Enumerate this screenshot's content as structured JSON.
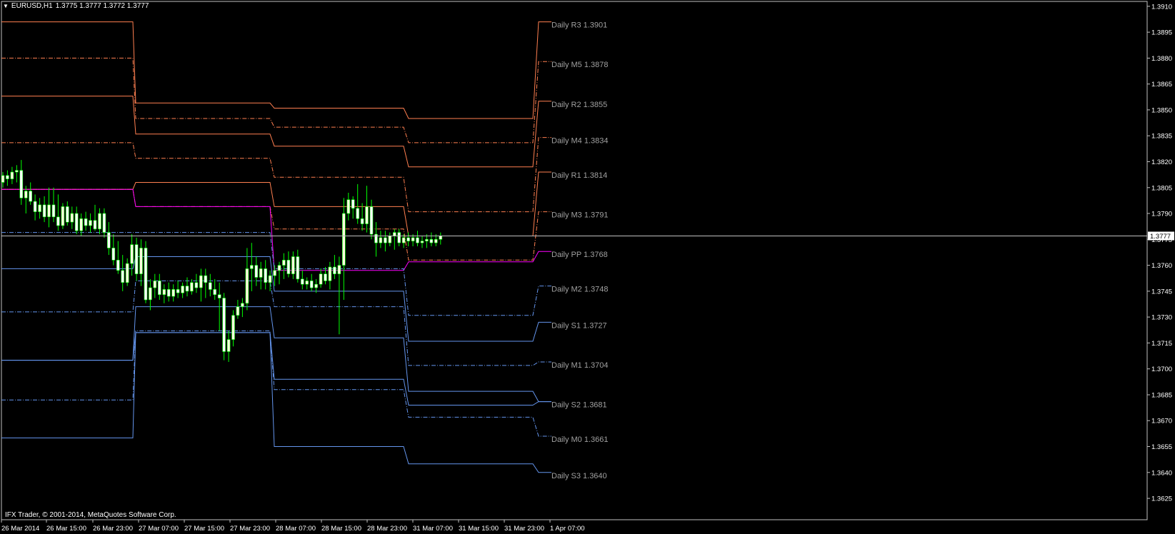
{
  "header": {
    "symbol": "EURUSD,H1",
    "ohlc": "1.3775 1.3777 1.3772 1.3777"
  },
  "copyright": "IFX Trader, © 2001-2014, MetaQuotes Software Corp.",
  "colors": {
    "background": "#000000",
    "frame": "#c0c0c0",
    "axis_text": "#ffffff",
    "level_label": "#a0a0a0",
    "resistance": "#ff7f50",
    "pivot": "#ff00ff",
    "support": "#6495ed",
    "bull_body": "#ffffe0",
    "bear_body": "#ffffff",
    "wick": "#00ff00",
    "bid_line": "#c0c0c0"
  },
  "chart_data": {
    "type": "candlestick",
    "symbol": "EURUSD",
    "timeframe": "H1",
    "ylim": [
      1.3618,
      1.3912
    ],
    "y_ticks": [
      "1.3910",
      "1.3895",
      "1.3880",
      "1.3865",
      "1.3850",
      "1.3835",
      "1.3820",
      "1.3805",
      "1.3790",
      "1.3775",
      "1.3760",
      "1.3745",
      "1.3730",
      "1.3715",
      "1.3700",
      "1.3685",
      "1.3670",
      "1.3655",
      "1.3640",
      "1.3625"
    ],
    "x_ticks": [
      "26 Mar 2014",
      "26 Mar 15:00",
      "26 Mar 23:00",
      "27 Mar 07:00",
      "27 Mar 15:00",
      "27 Mar 23:00",
      "28 Mar 07:00",
      "28 Mar 15:00",
      "28 Mar 23:00",
      "31 Mar 07:00",
      "31 Mar 15:00",
      "31 Mar 23:00",
      "1 Apr 07:00"
    ],
    "current_price": "1.3777",
    "levels": [
      {
        "name": "R3",
        "label": "Daily R3 1.3901",
        "kind": "resistance",
        "style": "solid",
        "values": [
          1.3901,
          1.3854,
          1.3851,
          1.3845,
          1.3901
        ]
      },
      {
        "name": "M5",
        "label": "Daily M5 1.3878",
        "kind": "resistance",
        "style": "dashdot",
        "values": [
          1.388,
          1.3845,
          1.384,
          1.3831,
          1.3878
        ]
      },
      {
        "name": "R2",
        "label": "Daily R2 1.3855",
        "kind": "resistance",
        "style": "solid",
        "values": [
          1.3858,
          1.3836,
          1.3829,
          1.3817,
          1.3855
        ]
      },
      {
        "name": "M4",
        "label": "Daily M4 1.3834",
        "kind": "resistance",
        "style": "dashdot",
        "values": [
          1.3831,
          1.3822,
          1.3811,
          1.3791,
          1.3834
        ]
      },
      {
        "name": "R1",
        "label": "Daily R1 1.3814",
        "kind": "resistance",
        "style": "solid",
        "values": [
          1.3804,
          1.3808,
          1.3794,
          1.3777,
          1.3814
        ]
      },
      {
        "name": "M3",
        "label": "Daily M3 1.3791",
        "kind": "resistance",
        "style": "dashdot",
        "values": [
          1.3804,
          1.3794,
          1.3781,
          1.3763,
          1.3791
        ]
      },
      {
        "name": "PP",
        "label": "Daily PP 1.3768",
        "kind": "pivot",
        "style": "solid",
        "values": [
          1.3804,
          1.3794,
          1.3757,
          1.3762,
          1.3768
        ]
      },
      {
        "name": "M2",
        "label": "Daily M2 1.3748",
        "kind": "support",
        "style": "dashdot",
        "values": [
          1.3779,
          1.3779,
          1.3758,
          1.3731,
          1.3748
        ]
      },
      {
        "name": "S1",
        "label": "Daily S1 1.3727",
        "kind": "support",
        "style": "solid",
        "values": [
          1.3758,
          1.3765,
          1.3745,
          1.3716,
          1.3727
        ]
      },
      {
        "name": "M1",
        "label": "Daily M1 1.3704",
        "kind": "support",
        "style": "dashdot",
        "values": [
          1.3733,
          1.3751,
          1.3736,
          1.3702,
          1.3704
        ]
      },
      {
        "name": "S2",
        "label": "Daily S2 1.3681",
        "kind": "support",
        "style": "solid",
        "values": [
          1.3705,
          1.3736,
          1.3718,
          1.3687,
          1.3681
        ]
      },
      {
        "name": "M0",
        "label": "Daily M0 1.3661",
        "kind": "support",
        "style": "dashdot",
        "values": [
          1.3682,
          1.3722,
          1.3688,
          1.3672,
          1.3661
        ]
      },
      {
        "name": "S1b",
        "label": "",
        "kind": "support",
        "style": "solid",
        "values": [
          1.3705,
          1.3721,
          1.3694,
          1.3679,
          1.3681
        ]
      },
      {
        "name": "S3",
        "label": "Daily S3 1.3640",
        "kind": "support",
        "style": "solid",
        "values": [
          1.366,
          1.3721,
          1.3655,
          1.3645,
          1.364
        ]
      }
    ],
    "candles": [
      [
        1.3808,
        1.3814,
        1.3805,
        1.3812
      ],
      [
        1.3812,
        1.3815,
        1.3806,
        1.381
      ],
      [
        1.381,
        1.3817,
        1.3807,
        1.3814
      ],
      [
        1.3814,
        1.3818,
        1.3808,
        1.3815
      ],
      [
        1.3815,
        1.3821,
        1.3795,
        1.3799
      ],
      [
        1.3799,
        1.3806,
        1.379,
        1.3803
      ],
      [
        1.3803,
        1.3808,
        1.3795,
        1.3797
      ],
      [
        1.3797,
        1.3801,
        1.3786,
        1.3791
      ],
      [
        1.3791,
        1.3799,
        1.3787,
        1.3795
      ],
      [
        1.3795,
        1.38,
        1.3785,
        1.3788
      ],
      [
        1.3788,
        1.3805,
        1.3782,
        1.3795
      ],
      [
        1.3795,
        1.3805,
        1.3785,
        1.3788
      ],
      [
        1.3788,
        1.3801,
        1.378,
        1.3783
      ],
      [
        1.3783,
        1.3796,
        1.3781,
        1.3794
      ],
      [
        1.3794,
        1.3797,
        1.3783,
        1.3785
      ],
      [
        1.3785,
        1.3794,
        1.3781,
        1.379
      ],
      [
        1.379,
        1.3794,
        1.3778,
        1.378
      ],
      [
        1.378,
        1.379,
        1.3777,
        1.3787
      ],
      [
        1.3787,
        1.3791,
        1.378,
        1.3783
      ],
      [
        1.3783,
        1.379,
        1.3779,
        1.3786
      ],
      [
        1.3786,
        1.3795,
        1.378,
        1.3781
      ],
      [
        1.3781,
        1.3793,
        1.3778,
        1.379
      ],
      [
        1.379,
        1.3793,
        1.3776,
        1.3779
      ],
      [
        1.3779,
        1.3785,
        1.3766,
        1.377
      ],
      [
        1.377,
        1.3778,
        1.376,
        1.3763
      ],
      [
        1.3763,
        1.3774,
        1.3755,
        1.3757
      ],
      [
        1.3757,
        1.3766,
        1.3745,
        1.375
      ],
      [
        1.375,
        1.3764,
        1.3748,
        1.3761
      ],
      [
        1.3761,
        1.3778,
        1.3754,
        1.3772
      ],
      [
        1.3772,
        1.3776,
        1.3751,
        1.3755
      ],
      [
        1.3755,
        1.3775,
        1.3748,
        1.377
      ],
      [
        1.377,
        1.3774,
        1.3738,
        1.374
      ],
      [
        1.374,
        1.3752,
        1.3734,
        1.3747
      ],
      [
        1.3747,
        1.3755,
        1.3741,
        1.3751
      ],
      [
        1.3751,
        1.3755,
        1.374,
        1.3743
      ],
      [
        1.3743,
        1.3749,
        1.3738,
        1.3746
      ],
      [
        1.3746,
        1.375,
        1.3739,
        1.3742
      ],
      [
        1.3742,
        1.3749,
        1.3739,
        1.3746
      ],
      [
        1.3746,
        1.3751,
        1.3741,
        1.3744
      ],
      [
        1.3744,
        1.375,
        1.3741,
        1.3748
      ],
      [
        1.3748,
        1.3753,
        1.3742,
        1.3745
      ],
      [
        1.3745,
        1.3752,
        1.3743,
        1.375
      ],
      [
        1.375,
        1.3755,
        1.3744,
        1.3747
      ],
      [
        1.3747,
        1.3758,
        1.3739,
        1.3754
      ],
      [
        1.3754,
        1.3758,
        1.3741,
        1.375
      ],
      [
        1.375,
        1.3755,
        1.3742,
        1.3746
      ],
      [
        1.3746,
        1.3752,
        1.374,
        1.3743
      ],
      [
        1.3743,
        1.375,
        1.3722,
        1.3741
      ],
      [
        1.3741,
        1.3744,
        1.3705,
        1.371
      ],
      [
        1.371,
        1.3722,
        1.3704,
        1.3717
      ],
      [
        1.3717,
        1.3734,
        1.3713,
        1.3731
      ],
      [
        1.3731,
        1.374,
        1.3729,
        1.3736
      ],
      [
        1.3736,
        1.3741,
        1.373,
        1.3738
      ],
      [
        1.3738,
        1.377,
        1.3734,
        1.3758
      ],
      [
        1.3758,
        1.3773,
        1.3745,
        1.376
      ],
      [
        1.376,
        1.3765,
        1.3748,
        1.3753
      ],
      [
        1.3753,
        1.3762,
        1.3746,
        1.3758
      ],
      [
        1.3758,
        1.3763,
        1.3746,
        1.375
      ],
      [
        1.375,
        1.3757,
        1.3745,
        1.3754
      ],
      [
        1.3754,
        1.376,
        1.3748,
        1.3757
      ],
      [
        1.3757,
        1.3762,
        1.3749,
        1.376
      ],
      [
        1.376,
        1.3767,
        1.3752,
        1.3763
      ],
      [
        1.3763,
        1.3768,
        1.3753,
        1.3755
      ],
      [
        1.3755,
        1.3768,
        1.3752,
        1.3765
      ],
      [
        1.3765,
        1.3769,
        1.375,
        1.3752
      ],
      [
        1.3752,
        1.3757,
        1.3746,
        1.3749
      ],
      [
        1.3749,
        1.3753,
        1.3746,
        1.3751
      ],
      [
        1.3751,
        1.3755,
        1.3745,
        1.3747
      ],
      [
        1.3747,
        1.3752,
        1.3744,
        1.3749
      ],
      [
        1.3749,
        1.3758,
        1.3747,
        1.3755
      ],
      [
        1.3755,
        1.3759,
        1.3749,
        1.3751
      ],
      [
        1.3751,
        1.3762,
        1.3746,
        1.3759
      ],
      [
        1.3759,
        1.3766,
        1.3752,
        1.3755
      ],
      [
        1.3755,
        1.3765,
        1.372,
        1.376
      ],
      [
        1.376,
        1.3799,
        1.374,
        1.379
      ],
      [
        1.379,
        1.3802,
        1.3786,
        1.3798
      ],
      [
        1.3798,
        1.38,
        1.3787,
        1.3793
      ],
      [
        1.3793,
        1.3807,
        1.3784,
        1.3787
      ],
      [
        1.3787,
        1.3796,
        1.378,
        1.3784
      ],
      [
        1.3784,
        1.3806,
        1.3779,
        1.3794
      ],
      [
        1.3794,
        1.3798,
        1.3775,
        1.3778
      ],
      [
        1.3778,
        1.3785,
        1.3765,
        1.3773
      ],
      [
        1.3773,
        1.378,
        1.377,
        1.3776
      ],
      [
        1.3776,
        1.378,
        1.3768,
        1.3773
      ],
      [
        1.3773,
        1.3779,
        1.3771,
        1.3777
      ],
      [
        1.3777,
        1.3781,
        1.3769,
        1.3779
      ],
      [
        1.3779,
        1.3781,
        1.3771,
        1.3773
      ],
      [
        1.3773,
        1.3778,
        1.377,
        1.3776
      ],
      [
        1.3776,
        1.3779,
        1.3771,
        1.3774
      ],
      [
        1.3774,
        1.3778,
        1.3771,
        1.3776
      ],
      [
        1.3776,
        1.378,
        1.3771,
        1.3773
      ],
      [
        1.3773,
        1.3777,
        1.377,
        1.3774
      ],
      [
        1.3774,
        1.3778,
        1.377,
        1.3775
      ],
      [
        1.3775,
        1.3779,
        1.3771,
        1.3773
      ],
      [
        1.3773,
        1.3778,
        1.3771,
        1.3775
      ],
      [
        1.3775,
        1.3779,
        1.3772,
        1.3777
      ]
    ]
  }
}
